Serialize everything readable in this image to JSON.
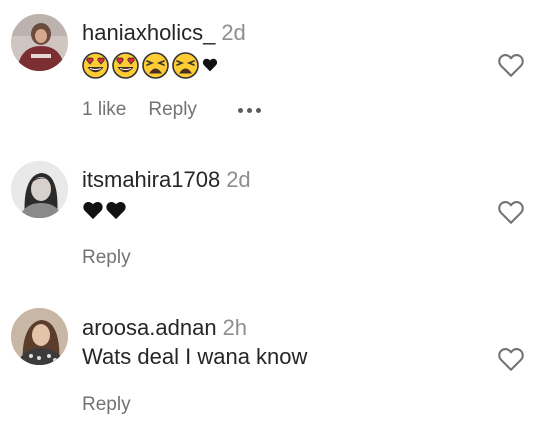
{
  "comments": [
    {
      "username": "haniaxholics_",
      "age": "2d",
      "text": "",
      "emojis": [
        "heart-eyes-emoji",
        "heart-eyes-emoji",
        "weary-face-emoji",
        "weary-face-emoji",
        "black-heart-emoji"
      ],
      "likes_label": "1 like",
      "reply_label": "Reply",
      "has_more": true
    },
    {
      "username": "itsmahira1708",
      "age": "2d",
      "text": "",
      "emojis": [
        "black-heart-emoji",
        "black-heart-emoji"
      ],
      "likes_label": "",
      "reply_label": "Reply",
      "has_more": false
    },
    {
      "username": "aroosa.adnan",
      "age": "2h",
      "text": "Wats deal I wana know",
      "emojis": [],
      "likes_label": "",
      "reply_label": "Reply",
      "has_more": false
    }
  ],
  "colors": {
    "text": "#262626",
    "secondary": "#8e8e8e",
    "action": "#737373",
    "emoji_face": "#ffcc33",
    "emoji_heart": "#e8283c"
  }
}
